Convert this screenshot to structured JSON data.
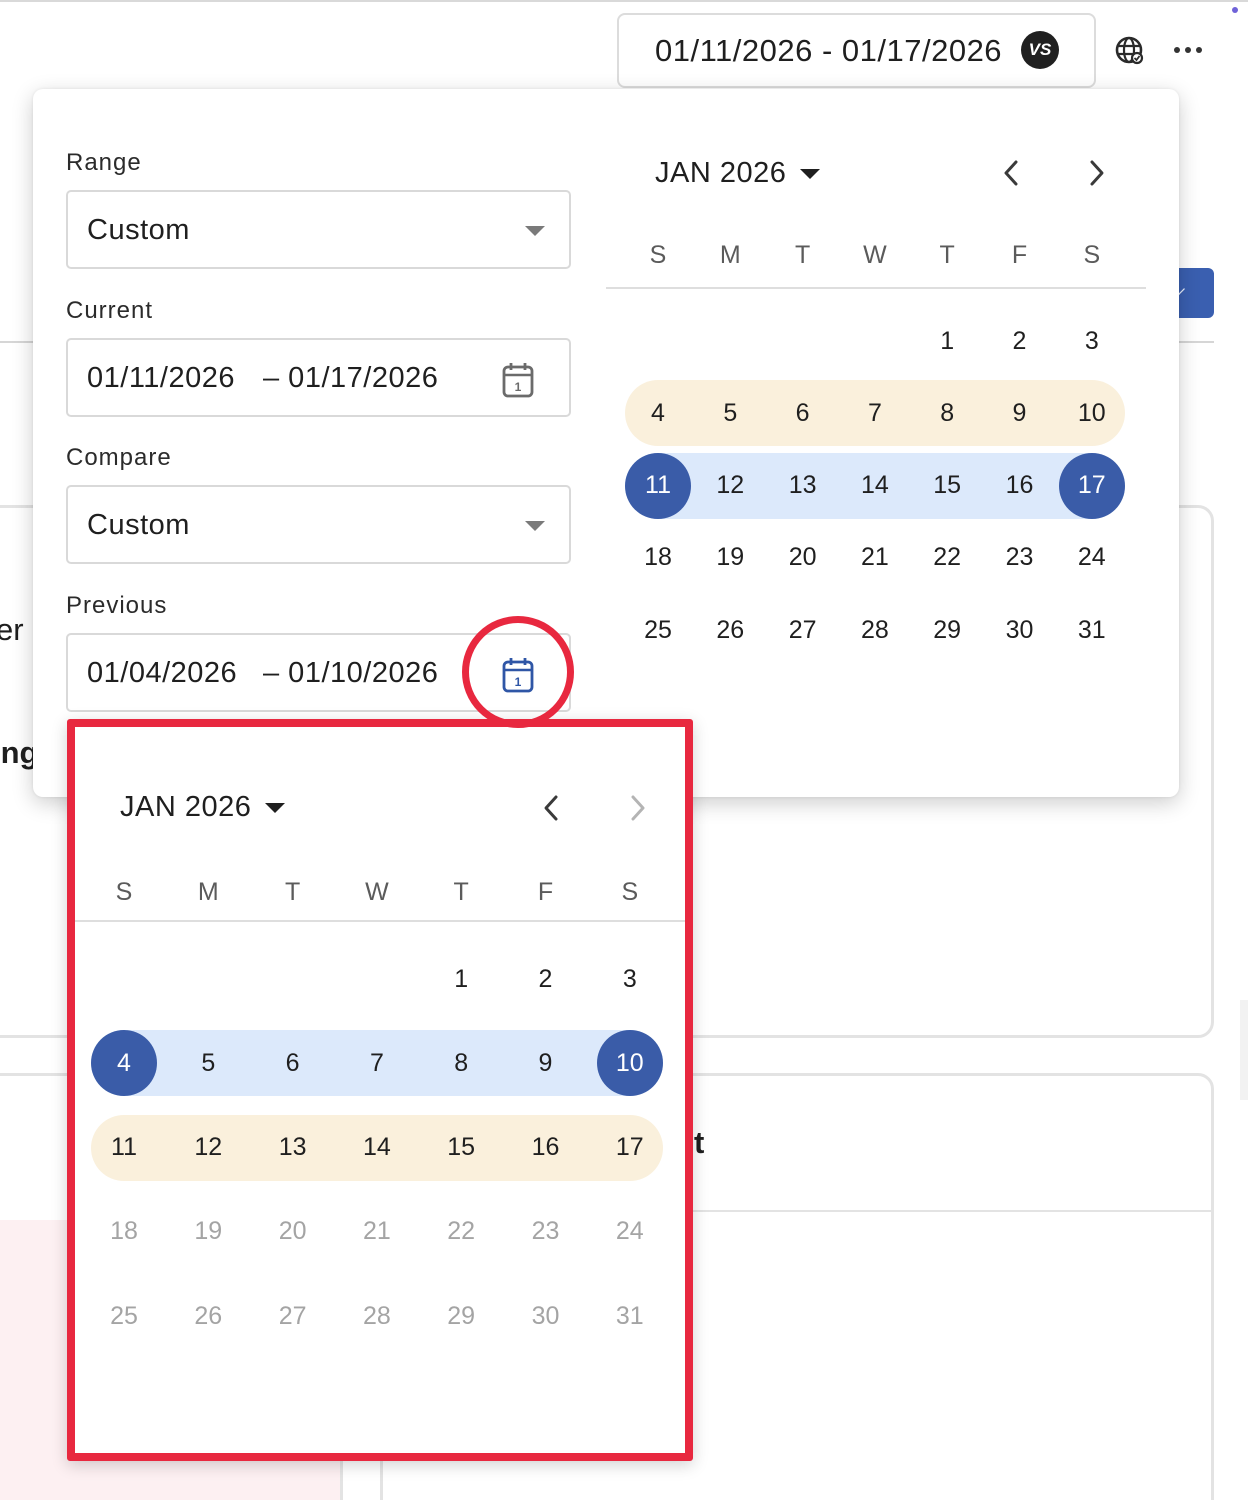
{
  "header": {
    "date_range": "01/11/2026 - 01/17/2026",
    "vs_badge": "VS",
    "globe_icon": "globe-icon",
    "more_icon": "more-horizontal-icon"
  },
  "background": {
    "fragment_er": "er",
    "fragment_ing": "ing",
    "fragment_t": "t"
  },
  "popover": {
    "range_label": "Range",
    "range_value": "Custom",
    "current_label": "Current",
    "current_start": "01/11/2026",
    "current_end": "– 01/17/2026",
    "compare_label": "Compare",
    "compare_value": "Custom",
    "previous_label": "Previous",
    "previous_start": "01/04/2026",
    "previous_end": "– 01/10/2026",
    "calendar_icon": "calendar-icon"
  },
  "main_calendar": {
    "month_label": "JAN 2026",
    "weekdays": [
      "S",
      "M",
      "T",
      "W",
      "T",
      "F",
      "S"
    ],
    "weeks": [
      [
        "",
        "",
        "",
        "",
        "1",
        "2",
        "3"
      ],
      [
        "4",
        "5",
        "6",
        "7",
        "8",
        "9",
        "10"
      ],
      [
        "11",
        "12",
        "13",
        "14",
        "15",
        "16",
        "17"
      ],
      [
        "18",
        "19",
        "20",
        "21",
        "22",
        "23",
        "24"
      ],
      [
        "25",
        "26",
        "27",
        "28",
        "29",
        "30",
        "31"
      ]
    ],
    "selected_range": {
      "start": "11",
      "end": "17"
    },
    "compare_range": {
      "start": "4",
      "end": "10"
    }
  },
  "previous_calendar": {
    "month_label": "JAN 2026",
    "weekdays": [
      "S",
      "M",
      "T",
      "W",
      "T",
      "F",
      "S"
    ],
    "weeks": [
      [
        "",
        "",
        "",
        "",
        "1",
        "2",
        "3"
      ],
      [
        "4",
        "5",
        "6",
        "7",
        "8",
        "9",
        "10"
      ],
      [
        "11",
        "12",
        "13",
        "14",
        "15",
        "16",
        "17"
      ],
      [
        "18",
        "19",
        "20",
        "21",
        "22",
        "23",
        "24"
      ],
      [
        "25",
        "26",
        "27",
        "28",
        "29",
        "30",
        "31"
      ]
    ],
    "selected_range": {
      "start": "4",
      "end": "10"
    },
    "compare_range": {
      "start": "11",
      "end": "17"
    },
    "disabled_from": "18",
    "next_disabled": true
  },
  "colors": {
    "selected": "#3a5ca8",
    "selected_band": "#dce9fb",
    "compare_band": "#faf0dc",
    "annotation_red": "#e8283f"
  }
}
